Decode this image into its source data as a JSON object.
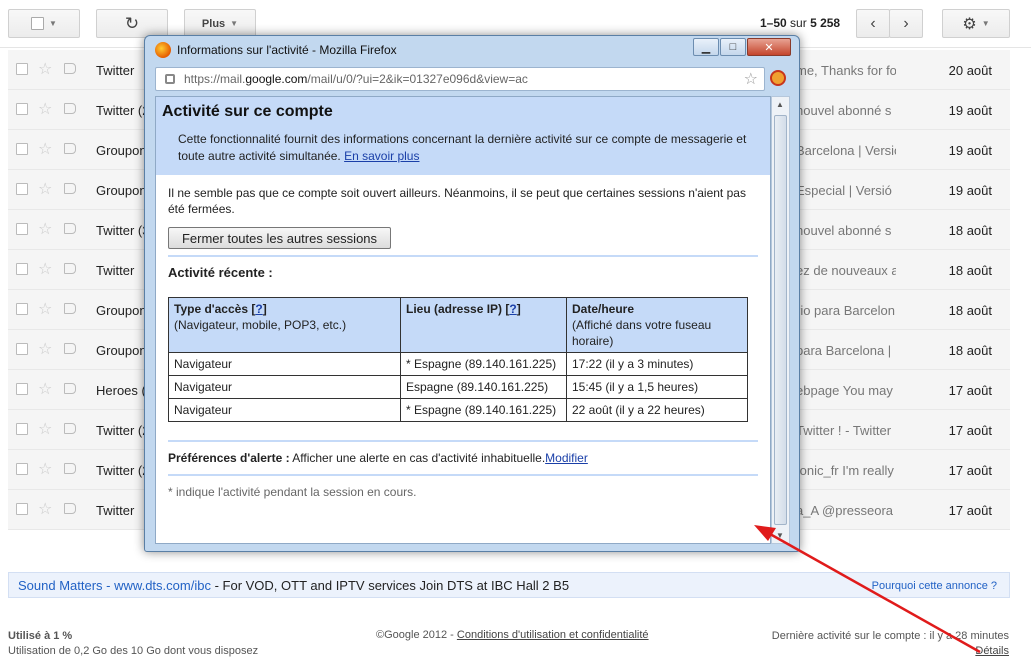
{
  "toolbar": {
    "more_label": "Plus",
    "pager_range": "1–50",
    "pager_of": "sur",
    "pager_total": "5 258"
  },
  "mail_rows": [
    {
      "sender": "Twitter",
      "snippet": "me, Thanks for fo",
      "date": "20 août"
    },
    {
      "sender": "Twitter (2",
      "snippet": "nouvel abonné s",
      "date": "19 août"
    },
    {
      "sender": "Groupon",
      "snippet": "Barcelona | Versió",
      "date": "19 août"
    },
    {
      "sender": "Groupon",
      "snippet": "Especial | Versió",
      "date": "19 août"
    },
    {
      "sender": "Twitter (3",
      "snippet": "nouvel abonné s",
      "date": "18 août"
    },
    {
      "sender": "Twitter",
      "snippet": "ez de nouveaux a",
      "date": "18 août"
    },
    {
      "sender": "Groupon",
      "snippet": "rio para Barcelon",
      "date": "18 août"
    },
    {
      "sender": "Groupon",
      "snippet": "para Barcelona | ",
      "date": "18 août"
    },
    {
      "sender": "Heroes (",
      "snippet": "ebpage You may",
      "date": "17 août"
    },
    {
      "sender": "Twitter (2",
      "snippet": "Twitter ! - Twitter",
      "date": "17 août"
    },
    {
      "sender": "Twitter (2",
      "snippet": "tonic_fr I'm really",
      "date": "17 août"
    },
    {
      "sender": "Twitter",
      "snippet": "a_A @presseora",
      "date": "17 août"
    }
  ],
  "popup": {
    "window_title": "Informations sur l'activité - Mozilla Firefox",
    "url_prefix": "https://mail.",
    "url_host": "google.com",
    "url_path": "/mail/u/0/?ui=2&ik=01327e096d&view=ac",
    "heading": "Activité sur ce compte",
    "description": "Cette fonctionnalité fournit des informations concernant la dernière activité sur ce compte de messagerie et toute autre activité simultanée.",
    "learn_more": "En savoir plus",
    "no_other_sessions": "Il ne semble pas que ce compte soit ouvert ailleurs. Néanmoins, il se peut que certaines sessions n'aient pas été fermées.",
    "close_sessions_button": "Fermer toutes les autres sessions",
    "recent_activity": "Activité récente :",
    "table_headers": {
      "access_title": "Type d'accès [",
      "access_q": "?",
      "access_close": "]",
      "access_sub": "(Navigateur, mobile, POP3, etc.)",
      "location_title": "Lieu (adresse IP) [",
      "location_q": "?",
      "location_close": "]",
      "date_title": "Date/heure",
      "date_sub": "(Affiché dans votre fuseau horaire)"
    },
    "table_rows": [
      {
        "access": "Navigateur",
        "location": "* Espagne (89.140.161.225)",
        "datetime": "17:22 (il y a 3 minutes)"
      },
      {
        "access": "Navigateur",
        "location": "Espagne (89.140.161.225)",
        "datetime": "15:45 (il y a 1,5 heures)"
      },
      {
        "access": "Navigateur",
        "location": "* Espagne (89.140.161.225)",
        "datetime": "22 août (il y a 22 heures)"
      }
    ],
    "alert_label": "Préférences d'alerte :",
    "alert_text": "Afficher une alerte en cas d'activité inhabituelle.",
    "alert_link": "Modifier",
    "note": "* indique l'activité pendant la session en cours."
  },
  "ad": {
    "title": "Sound Matters",
    "sep": "-",
    "url": "www.dts.com/ibc",
    "text": "- For VOD, OTT and IPTV services Join DTS at IBC Hall 2 B5",
    "why": "Pourquoi cette annonce ?"
  },
  "footer": {
    "usage_title": "Utilisé à 1 %",
    "usage_detail": "Utilisation de 0,2 Go des 10 Go dont vous disposez",
    "copyright": "©Google 2012 -",
    "terms_link": "Conditions d'utilisation et confidentialité",
    "last_activity": "Dernière activité sur le compte : il y a 28 minutes",
    "details_link": "Détails"
  },
  "colors": {
    "arrow": "#e01b1b",
    "link": "#1a3fa8",
    "header_bg": "#c5daf8"
  }
}
